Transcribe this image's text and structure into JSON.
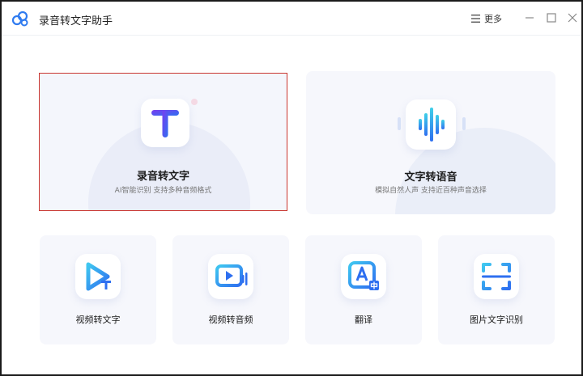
{
  "app": {
    "title": "录音转文字助手"
  },
  "titlebar": {
    "more_label": "更多"
  },
  "cards": {
    "audio_to_text": {
      "title": "录音转文字",
      "subtitle": "AI智能识别 支持多种音频格式"
    },
    "text_to_speech": {
      "title": "文字转语音",
      "subtitle": "模拟自然人声 支持近百种声音选择"
    }
  },
  "tools": [
    {
      "label": "视频转文字"
    },
    {
      "label": "视频转音频"
    },
    {
      "label": "翻译"
    },
    {
      "label": "图片文字识别"
    }
  ],
  "colors": {
    "accent": "#2f7bf0",
    "selected_border": "#c9352f",
    "card_bg": "#f6f7fc"
  }
}
